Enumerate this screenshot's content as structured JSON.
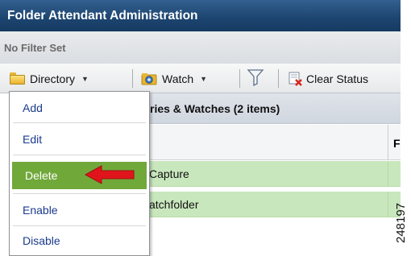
{
  "header": {
    "title": "Folder Attendant Administration"
  },
  "filter": {
    "status": "No Filter Set"
  },
  "toolbar": {
    "directory_label": "Directory",
    "watch_label": "Watch",
    "clear_status_label": "Clear Status",
    "dropdown_arrow": "▼"
  },
  "grid": {
    "title_partial": "ries & Watches (2 items)",
    "column2_partial": "F",
    "rows": [
      {
        "name_partial": "Capture"
      },
      {
        "name_partial": "atchfolder"
      }
    ]
  },
  "menu": {
    "items": [
      {
        "label": "Add"
      },
      {
        "label": "Edit"
      },
      {
        "label": "Delete",
        "selected": true
      },
      {
        "label": "Enable"
      },
      {
        "label": "Disable"
      }
    ]
  },
  "figure_id": "248197",
  "colors": {
    "titlebar": "#1c446f",
    "selected_menu": "#71a83a",
    "row_highlight": "#c9e7bd",
    "menu_text": "#1a3a8c",
    "callout_arrow": "#e0151b"
  }
}
